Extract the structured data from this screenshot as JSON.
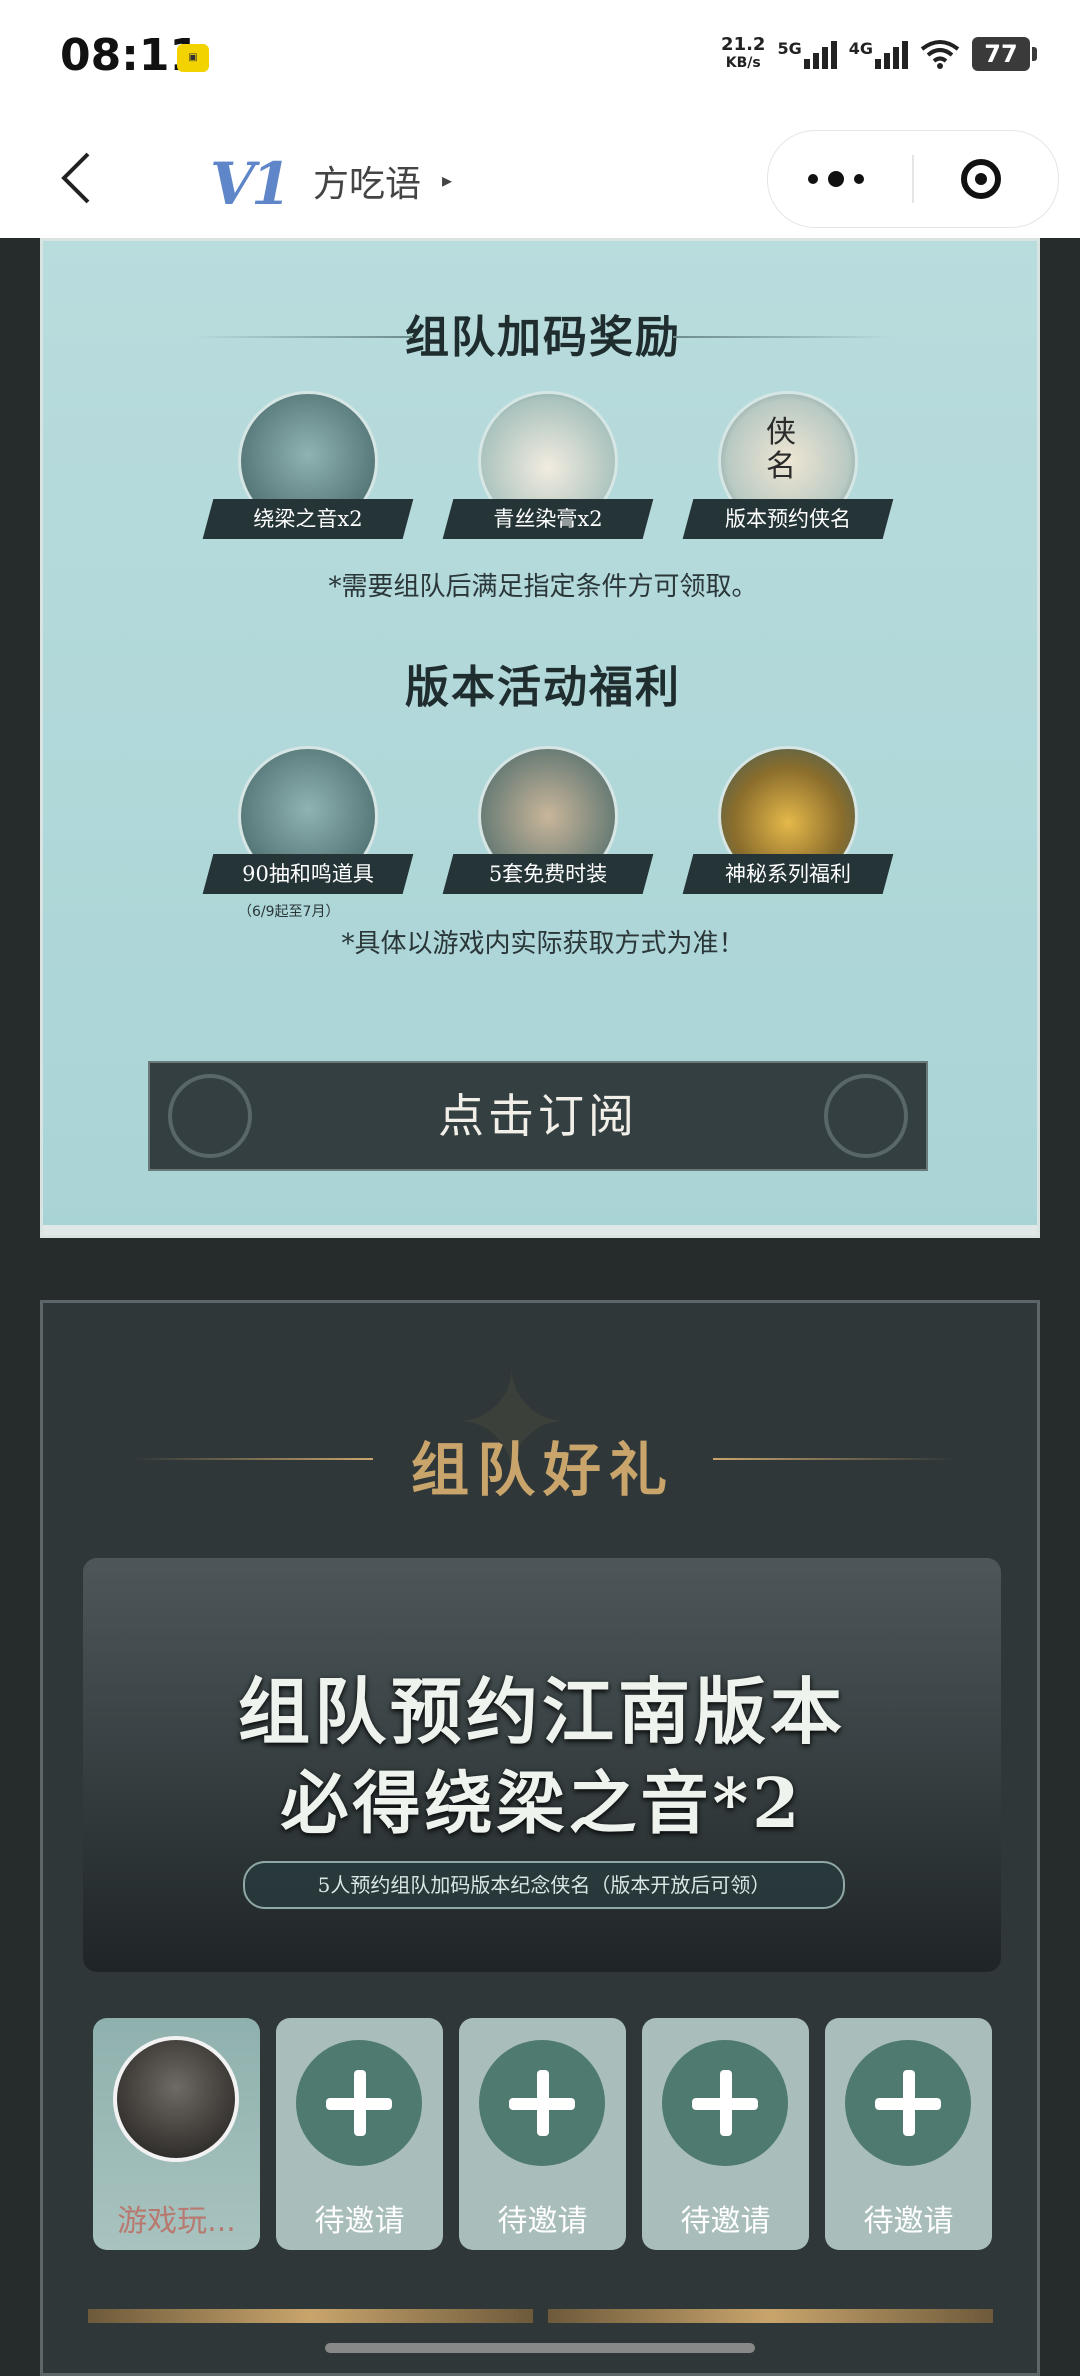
{
  "status_bar": {
    "time": "08:11",
    "notif_icon": "app-badge-icon",
    "net_speed_value": "21.2",
    "net_speed_unit": "KB/s",
    "signal1": "5G",
    "signal2": "4G",
    "battery": "77"
  },
  "nav": {
    "logo": "V1",
    "app_name": "方吃语",
    "arrow": "▸",
    "back_icon": "chevron-left-icon",
    "more_icon": "more-dots-icon",
    "close_icon": "miniapp-target-icon"
  },
  "rewards": {
    "team_title": "组队加码奖励",
    "team_items": [
      {
        "label": "绕梁之音x2",
        "icon": "melody-item-icon"
      },
      {
        "label": "青丝染膏x2",
        "icon": "dye-jar-icon"
      },
      {
        "label": "版本预约侠名",
        "icon": "scroll-name-icon",
        "scroll_text": "侠\n名"
      }
    ],
    "team_note": "*需要组队后满足指定条件方可领取。",
    "event_title": "版本活动福利",
    "event_items": [
      {
        "label": "90抽和鸣道具",
        "icon": "draw-item-icon",
        "sub": "（6/9起至7月）"
      },
      {
        "label": "5套免费时装",
        "icon": "costume-set-icon"
      },
      {
        "label": "神秘系列福利",
        "icon": "gold-treasure-icon"
      }
    ],
    "event_note": "*具体以游戏内实际获取方式为准！",
    "subscribe_label": "点击订阅"
  },
  "team_gift": {
    "title": "组队好礼",
    "banner_line1": "组队预约江南版本",
    "banner_line2": "必得绕梁之音*2",
    "banner_note": "5人预约组队加码版本纪念侠名（版本开放后可领）",
    "slots": [
      {
        "name": "游戏玩...",
        "type": "avatar"
      },
      {
        "name": "待邀请",
        "type": "invite"
      },
      {
        "name": "待邀请",
        "type": "invite"
      },
      {
        "name": "待邀请",
        "type": "invite"
      },
      {
        "name": "待邀请",
        "type": "invite"
      }
    ]
  },
  "colors": {
    "panel_bg": "#b9dcdd",
    "dark_bg": "#262b2c",
    "gold": "#c9a56c",
    "invite_slot": "#a9bdbb",
    "plus_circle": "#4f7a70"
  }
}
